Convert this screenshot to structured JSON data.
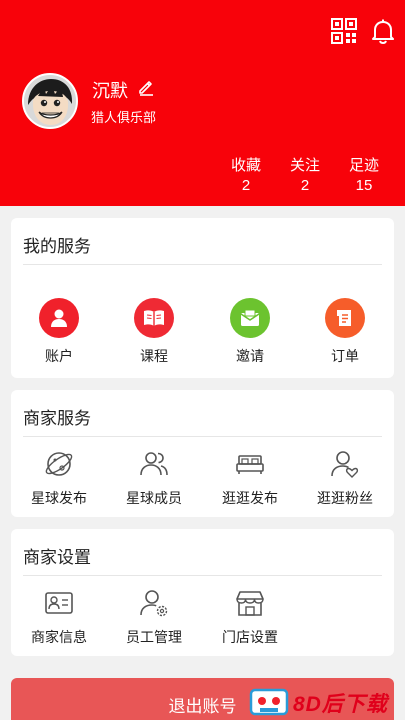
{
  "header": {
    "user": {
      "name": "沉默",
      "club": "猎人俱乐部"
    },
    "stats": [
      {
        "label": "收藏",
        "value": "2"
      },
      {
        "label": "关注",
        "value": "2"
      },
      {
        "label": "足迹",
        "value": "15"
      }
    ]
  },
  "my_services": {
    "title": "我的服务",
    "items": [
      {
        "label": "账户",
        "icon": "user-icon",
        "color": "#f0212b"
      },
      {
        "label": "课程",
        "icon": "book-icon",
        "color": "#ef2a34"
      },
      {
        "label": "邀请",
        "icon": "envelope-icon",
        "color": "#6cc32f"
      },
      {
        "label": "订单",
        "icon": "order-icon",
        "color": "#f65d2a"
      }
    ]
  },
  "merchant_services": {
    "title": "商家服务",
    "items": [
      {
        "label": "星球发布",
        "icon": "planet-icon"
      },
      {
        "label": "星球成员",
        "icon": "members-icon"
      },
      {
        "label": "逛逛发布",
        "icon": "bed-icon"
      },
      {
        "label": "逛逛粉丝",
        "icon": "fan-icon"
      }
    ]
  },
  "merchant_settings": {
    "title": "商家设置",
    "items": [
      {
        "label": "商家信息",
        "icon": "id-card-icon"
      },
      {
        "label": "员工管理",
        "icon": "staff-settings-icon"
      },
      {
        "label": "门店设置",
        "icon": "store-icon"
      }
    ]
  },
  "logout": {
    "label": "退出账号"
  },
  "watermark": {
    "text": "8D后下载"
  }
}
